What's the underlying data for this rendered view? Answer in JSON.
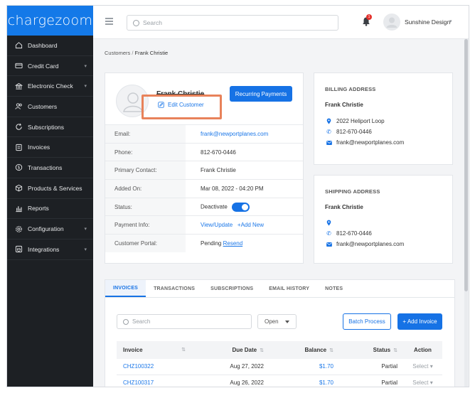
{
  "brand": {
    "logo_text": "chargezoom",
    "color": "#1479e8"
  },
  "sidebar": {
    "items": [
      {
        "label": "Dashboard",
        "icon": "home-icon",
        "has_submenu": false
      },
      {
        "label": "Credit Card",
        "icon": "credit-card-icon",
        "has_submenu": true
      },
      {
        "label": "Electronic Check",
        "icon": "bank-icon",
        "has_submenu": true
      },
      {
        "label": "Customers",
        "icon": "users-icon",
        "has_submenu": false
      },
      {
        "label": "Subscriptions",
        "icon": "refresh-icon",
        "has_submenu": false
      },
      {
        "label": "Invoices",
        "icon": "invoice-icon",
        "has_submenu": false
      },
      {
        "label": "Transactions",
        "icon": "dollar-icon",
        "has_submenu": false
      },
      {
        "label": "Products & Services",
        "icon": "box-icon",
        "has_submenu": false
      },
      {
        "label": "Reports",
        "icon": "bar-chart-icon",
        "has_submenu": false
      },
      {
        "label": "Configuration",
        "icon": "gear-icon",
        "has_submenu": true
      },
      {
        "label": "Integrations",
        "icon": "plug-icon",
        "has_submenu": true
      }
    ]
  },
  "topbar": {
    "search_placeholder": "Search",
    "notification_count": "1",
    "user_name": "Sunshine Design"
  },
  "breadcrumb": {
    "parent": "Customers",
    "separator": " / ",
    "current": "Frank Christie"
  },
  "profile": {
    "name": "Frank Christie",
    "edit_label": "Edit Customer",
    "recurring_label": "Recurring Payments",
    "fields": {
      "email": {
        "label": "Email:",
        "value": "frank@newportplanes.com"
      },
      "phone": {
        "label": "Phone:",
        "value": "812-670-0446"
      },
      "primary_contact": {
        "label": "Primary Contact:",
        "value": "Frank Christie"
      },
      "added_on": {
        "label": "Added On:",
        "value": "Mar 08, 2022 - 04:20 PM"
      },
      "status": {
        "label": "Status:",
        "value": "Deactivate",
        "toggle_on": true
      },
      "payment_info": {
        "label": "Payment Info:",
        "view_update": "View/Update",
        "add_new": "+Add New"
      },
      "customer_portal": {
        "label": "Customer Portal:",
        "value": "Pending",
        "resend": "Resend"
      }
    }
  },
  "billing": {
    "title": "BILLING ADDRESS",
    "name": "Frank Christie",
    "address": "2022 Heliport Loop",
    "phone": "812-670-0446",
    "email": "frank@newportplanes.com"
  },
  "shipping": {
    "title": "SHIPPING ADDRESS",
    "name": "Frank Christie",
    "address": "",
    "phone": "812-670-0446",
    "email": "frank@newportplanes.com"
  },
  "tabs": [
    {
      "label": "INVOICES",
      "active": true
    },
    {
      "label": "TRANSACTIONS",
      "active": false
    },
    {
      "label": "SUBSCRIPTIONS",
      "active": false
    },
    {
      "label": "EMAIL HISTORY",
      "active": false
    },
    {
      "label": "NOTES",
      "active": false
    }
  ],
  "invoices": {
    "search_placeholder": "Search",
    "filter_value": "Open",
    "batch_label": "Batch Process",
    "add_label": "+ Add Invoice",
    "columns": [
      "Invoice",
      "Due Date",
      "Balance",
      "Status",
      "Action"
    ],
    "rows": [
      {
        "invoice": "CHZ100322",
        "due_date": "Aug 27, 2022",
        "balance": "$1.70",
        "status": "Partial",
        "action": "Select"
      },
      {
        "invoice": "CHZ100317",
        "due_date": "Aug 26, 2022",
        "balance": "$1.70",
        "status": "Partial",
        "action": "Select"
      }
    ]
  },
  "colors": {
    "accent": "#1672e5",
    "highlight": "#e8825a",
    "sidebar_bg": "#1d2024"
  }
}
